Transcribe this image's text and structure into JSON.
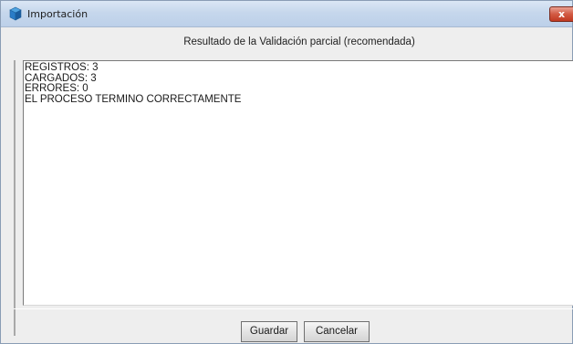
{
  "window": {
    "title": "Importación",
    "icon": "app-cube-icon",
    "close_label": "x"
  },
  "header": {
    "label": "Resultado de la Validación parcial (recomendada)"
  },
  "results": {
    "lines": [
      "REGISTROS: 3",
      "CARGADOS: 3",
      "ERRORES: 0",
      "EL PROCESO TERMINO CORRECTAMENTE"
    ]
  },
  "buttons": {
    "save_label": "Guardar",
    "cancel_label": "Cancelar"
  },
  "colors": {
    "titlebar": "#c6d7ec",
    "close": "#c13a22",
    "dialog_bg": "#eeeeee",
    "text_area_bg": "#ffffff"
  }
}
